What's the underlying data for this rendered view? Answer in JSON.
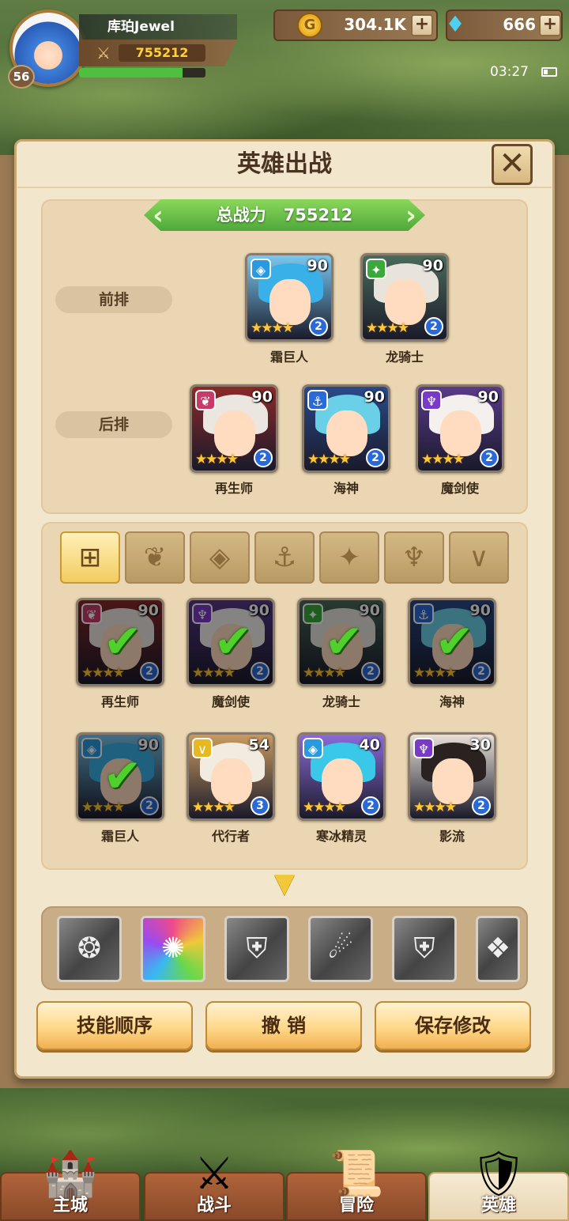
{
  "player": {
    "name": "库珀Jewel",
    "level": "56",
    "power": "755212",
    "xp_fraction": 0.82
  },
  "resources": {
    "coins": "304.1K",
    "gems": "666",
    "plus": "+"
  },
  "status": {
    "time": "03:27"
  },
  "panel": {
    "title": "英雄出战",
    "close": "✕",
    "total_power_label": "总战力",
    "total_power_value": "755212",
    "front_row_label": "前排",
    "back_row_label": "后排"
  },
  "front_row": [
    {
      "name": "霜巨人",
      "level": "90",
      "grade": "2",
      "element": "ice",
      "elem_glyph": "◈",
      "elem_color": "#2a9ae0",
      "hair": "#3ab0e8",
      "bg": "#7ac8f0"
    },
    {
      "name": "龙骑士",
      "level": "90",
      "grade": "2",
      "element": "dragon",
      "elem_glyph": "✦",
      "elem_color": "#3aa83a",
      "hair": "#e8e4dc",
      "bg": "#4a6a5a"
    }
  ],
  "back_row": [
    {
      "name": "再生师",
      "level": "90",
      "grade": "2",
      "element": "life",
      "elem_glyph": "❦",
      "elem_color": "#c83a6a",
      "hair": "#ece6e0",
      "bg": "#8a2a2a"
    },
    {
      "name": "海神",
      "level": "90",
      "grade": "2",
      "element": "sea",
      "elem_glyph": "⚓",
      "elem_color": "#2a6ad8",
      "hair": "#6ad0e8",
      "bg": "#2a4a8a"
    },
    {
      "name": "魔剑使",
      "level": "90",
      "grade": "2",
      "element": "dark",
      "elem_glyph": "♆",
      "elem_color": "#7a3ac8",
      "hair": "#f4f0ee",
      "bg": "#5a3a8a"
    }
  ],
  "filters": [
    {
      "id": "all",
      "glyph": "⊞",
      "active": true
    },
    {
      "id": "life",
      "glyph": "❦",
      "active": false
    },
    {
      "id": "ice",
      "glyph": "◈",
      "active": false
    },
    {
      "id": "sea",
      "glyph": "⚓",
      "active": false
    },
    {
      "id": "dragon",
      "glyph": "✦",
      "active": false
    },
    {
      "id": "dark",
      "glyph": "♆",
      "active": false
    },
    {
      "id": "light",
      "glyph": "∨",
      "active": false
    }
  ],
  "pool": [
    {
      "name": "再生师",
      "level": "90",
      "grade": "2",
      "selected": true,
      "elem_glyph": "❦",
      "elem_color": "#c83a6a",
      "hair": "#ece6e0",
      "bg": "#8a2a2a"
    },
    {
      "name": "魔剑使",
      "level": "90",
      "grade": "2",
      "selected": true,
      "elem_glyph": "♆",
      "elem_color": "#7a3ac8",
      "hair": "#f4f0ee",
      "bg": "#5a3a8a"
    },
    {
      "name": "龙骑士",
      "level": "90",
      "grade": "2",
      "selected": true,
      "elem_glyph": "✦",
      "elem_color": "#3aa83a",
      "hair": "#e8e4dc",
      "bg": "#4a6a5a"
    },
    {
      "name": "海神",
      "level": "90",
      "grade": "2",
      "selected": true,
      "elem_glyph": "⚓",
      "elem_color": "#2a6ad8",
      "hair": "#6ad0e8",
      "bg": "#2a4a8a"
    },
    {
      "name": "霜巨人",
      "level": "90",
      "grade": "2",
      "selected": true,
      "elem_glyph": "◈",
      "elem_color": "#2a9ae0",
      "hair": "#3ab0e8",
      "bg": "#7ac8f0"
    },
    {
      "name": "代行者",
      "level": "54",
      "grade": "3",
      "selected": false,
      "elem_glyph": "∨",
      "elem_color": "#e8b820",
      "hair": "#f2ece0",
      "bg": "#c89a60"
    },
    {
      "name": "寒冰精灵",
      "level": "40",
      "grade": "2",
      "selected": false,
      "elem_glyph": "◈",
      "elem_color": "#2a9ae0",
      "hair": "#3ac8e8",
      "bg": "#8a6ad8"
    },
    {
      "name": "影流",
      "level": "30",
      "grade": "2",
      "selected": false,
      "elem_glyph": "♆",
      "elem_color": "#7a3ac8",
      "hair": "#2a2220",
      "bg": "#e8e0d8"
    }
  ],
  "skills": [
    {
      "id": "wing-skill",
      "glyph": "❂",
      "colored": false
    },
    {
      "id": "burst-skill",
      "glyph": "✺",
      "colored": true
    },
    {
      "id": "shield-skill-1",
      "glyph": "⛨",
      "colored": false
    },
    {
      "id": "orb-skill",
      "glyph": "☄",
      "colored": false
    },
    {
      "id": "shield-skill-2",
      "glyph": "⛨",
      "colored": false
    },
    {
      "id": "crystal-skill",
      "glyph": "❖",
      "colored": false
    }
  ],
  "actions": {
    "skill_order": "技能顺序",
    "undo": "撤 销",
    "save": "保存修改"
  },
  "nav": [
    {
      "label": "主城",
      "icon": "🏰",
      "active": false
    },
    {
      "label": "战斗",
      "icon": "⚔",
      "active": false
    },
    {
      "label": "冒险",
      "icon": "📜",
      "active": false
    },
    {
      "label": "英雄",
      "icon": "🛡",
      "active": true
    }
  ]
}
